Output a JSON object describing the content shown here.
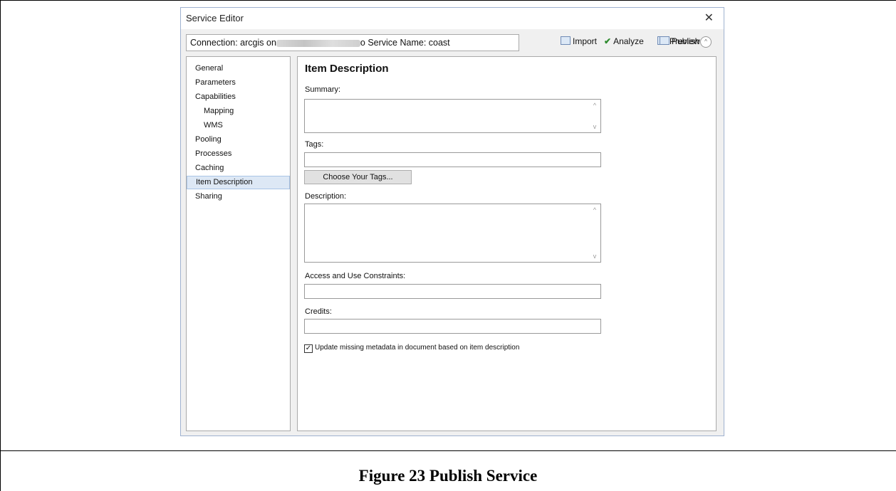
{
  "window": {
    "title": "Service Editor",
    "close_glyph": "✕"
  },
  "connection": {
    "prefix": "Connection: arcgis on",
    "suffix": "o Service Name: coast"
  },
  "toolbar": {
    "import_label": "Import",
    "analyze_label": "Analyze",
    "preview_label": "Preview",
    "publish_label": "Publish",
    "collapse_glyph": "^"
  },
  "nav": {
    "items": [
      {
        "label": "General"
      },
      {
        "label": "Parameters"
      },
      {
        "label": "Capabilities"
      },
      {
        "label": "Mapping"
      },
      {
        "label": "WMS"
      },
      {
        "label": "Pooling"
      },
      {
        "label": "Processes"
      },
      {
        "label": "Caching"
      },
      {
        "label": "Item Description",
        "selected": true
      },
      {
        "label": "Sharing"
      }
    ]
  },
  "form": {
    "heading": "Item Description",
    "summary_label": "Summary:",
    "summary_value": "",
    "tags_label": "Tags:",
    "tags_value": "",
    "choose_tags_label": "Choose Your Tags...",
    "description_label": "Description:",
    "description_value": "",
    "access_label": "Access and Use Constraints:",
    "access_value": "",
    "credits_label": "Credits:",
    "credits_value": "",
    "update_metadata_label": "Update missing metadata in document based on item description",
    "update_metadata_checked": true,
    "check_glyph": "✓",
    "scroll_up_glyph": "^",
    "scroll_down_glyph": "v"
  },
  "caption": "Figure 23 Publish Service"
}
